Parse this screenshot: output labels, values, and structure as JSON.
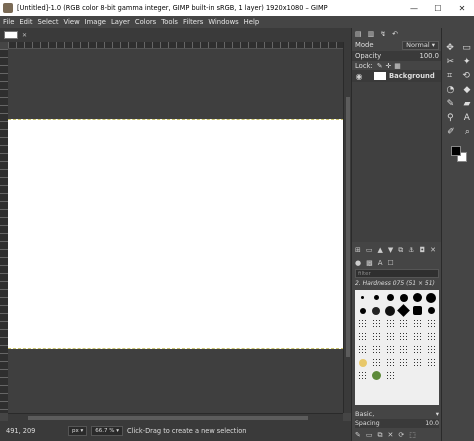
{
  "window": {
    "title": "[Untitled]-1.0 (RGB color 8-bit gamma integer, GIMP built-in sRGB, 1 layer) 1920x1080 – GIMP",
    "minimize": "—",
    "maximize": "☐",
    "close": "✕"
  },
  "menu": [
    "File",
    "Edit",
    "Select",
    "View",
    "Image",
    "Layer",
    "Colors",
    "Tools",
    "Filters",
    "Windows",
    "Help"
  ],
  "image_tab": {
    "close": "✕"
  },
  "status": {
    "coords": "491, 209",
    "unit": "px ▾",
    "zoom": "66.7 % ▾",
    "message": "Click-Drag to create a new selection"
  },
  "layers": {
    "mode_label": "Mode",
    "mode_value": "Normal ▾",
    "opacity_label": "Opacity",
    "opacity_value": "100.0",
    "lock_label": "Lock:",
    "layer_name": "Background"
  },
  "brushes": {
    "filter_placeholder": "filter",
    "current": "2. Hardness 075 (51 × 51)",
    "preset": "Basic,",
    "spacing_label": "Spacing",
    "spacing_value": "10.0"
  }
}
